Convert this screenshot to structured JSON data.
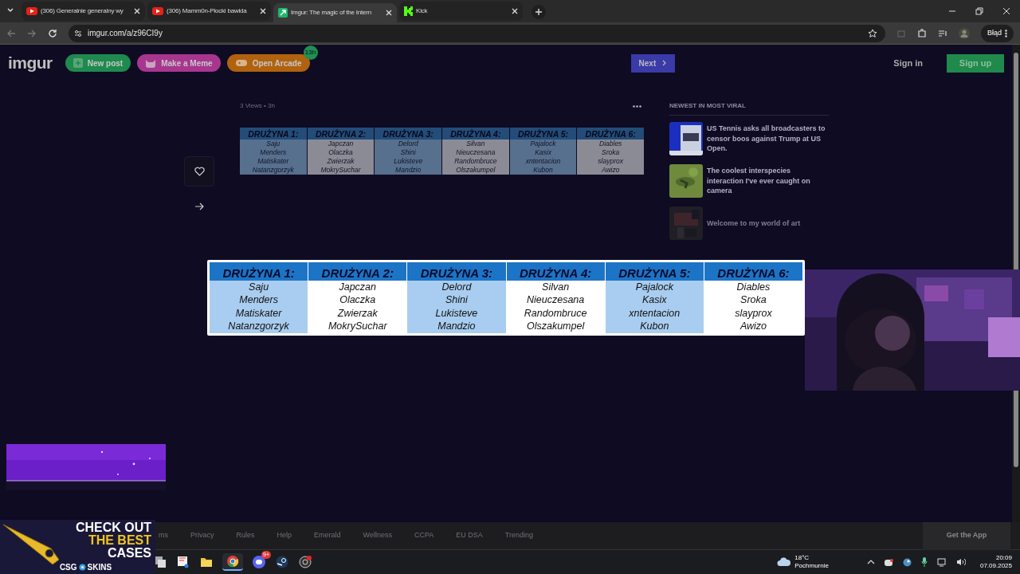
{
  "browser": {
    "tabs": [
      {
        "title": "(306) Generalnie generalny wy",
        "kind": "video",
        "selected": false
      },
      {
        "title": "(306) Mamm0n-Płocki bawida",
        "kind": "video",
        "selected": false
      },
      {
        "title": "Imgur: The magic of the Intern",
        "kind": "imgur",
        "selected": true
      },
      {
        "title": "Kick",
        "kind": "kick",
        "selected": false
      }
    ],
    "address": "imgur.com/a/z96CI9y",
    "profile_label": "Błąd"
  },
  "header": {
    "logo": "imgur",
    "buttons": [
      {
        "label": "New post",
        "kind": "post"
      },
      {
        "label": "Make a Meme",
        "kind": "meme"
      },
      {
        "label": "Open Arcade",
        "kind": "arcade",
        "badge": "13h"
      }
    ],
    "next": "Next",
    "sign_in": "Sign in",
    "sign_up": "Sign up"
  },
  "post": {
    "meta": "3 Views • 3h",
    "teams": [
      {
        "header": "DRUŻYNA 1:",
        "members": [
          "Saju",
          "Menders",
          "Matiskater",
          "Natanzgorzyk"
        ],
        "shaded": true
      },
      {
        "header": "DRUŻYNA 2:",
        "members": [
          "Japczan",
          "Olaczka",
          "Zwierzak",
          "MokrySuchar"
        ],
        "shaded": false
      },
      {
        "header": "DRUŻYNA 3:",
        "members": [
          "Delord",
          "Shini",
          "Lukisteve",
          "Mandzio"
        ],
        "shaded": true
      },
      {
        "header": "DRUŻYNA 4:",
        "members": [
          "Silvan",
          "Nieuczesana",
          "Randombruce",
          "Olszakumpel"
        ],
        "shaded": false
      },
      {
        "header": "DRUŻYNA 5:",
        "members": [
          "Pajalock",
          "Kasix",
          "xntentacion",
          "Kubon"
        ],
        "shaded": true
      },
      {
        "header": "DRUŻYNA 6:",
        "members": [
          "Diables",
          "Sroka",
          "slayprox",
          "Awizo"
        ],
        "shaded": false
      }
    ]
  },
  "sidebar": {
    "title": "NEWEST IN MOST VIRAL",
    "items": [
      {
        "title": "US Tennis asks all broadcasters to censor boos against Trump at US Open.",
        "faded": false
      },
      {
        "title": "The coolest interspecies interaction I've ever caught on camera",
        "faded": false
      },
      {
        "title": "Welcome to my world of art",
        "faded": true
      }
    ]
  },
  "overlay_table": {
    "teams": [
      {
        "header": "DRUŻYNA 1:",
        "members": [
          "Saju",
          "Menders",
          "Matiskater",
          "Natanzgorzyk"
        ],
        "shaded": true
      },
      {
        "header": "DRUŻYNA 2:",
        "members": [
          "Japczan",
          "Olaczka",
          "Zwierzak",
          "MokrySuchar"
        ],
        "shaded": false
      },
      {
        "header": "DRUŻYNA 3:",
        "members": [
          "Delord",
          "Shini",
          "Lukisteve",
          "Mandzio"
        ],
        "shaded": true
      },
      {
        "header": "DRUŻYNA 4:",
        "members": [
          "Silvan",
          "Nieuczesana",
          "Randombruce",
          "Olszakumpel"
        ],
        "shaded": false
      },
      {
        "header": "DRUŻYNA 5:",
        "members": [
          "Pajalock",
          "Kasix",
          "xntentacion",
          "Kubon"
        ],
        "shaded": true
      },
      {
        "header": "DRUŻYNA 6:",
        "members": [
          "Diables",
          "Sroka",
          "slayprox",
          "Awizo"
        ],
        "shaded": false
      }
    ]
  },
  "footer": {
    "links": [
      "ms",
      "Privacy",
      "Rules",
      "Help",
      "Emerald",
      "Wellness",
      "CCPA",
      "EU DSA",
      "Trending"
    ],
    "get_app": "Get the App"
  },
  "ad_banner": {
    "lines": [
      "CHECK OUT",
      "THE BEST",
      "CASES"
    ],
    "brand_left": "CSG",
    "brand_right": "SKINS"
  },
  "taskbar": {
    "discord_badge": "9+",
    "temperature": "18°C",
    "condition": "Pochmurnie",
    "time": "20:09",
    "date": "07.09.2025"
  }
}
